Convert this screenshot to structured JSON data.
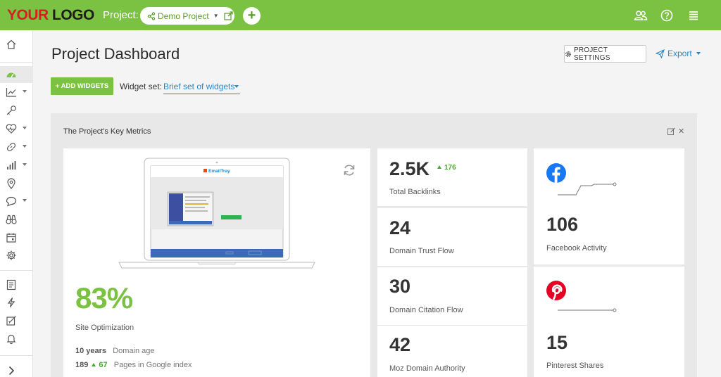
{
  "brand": {
    "logo_a": "YOUR",
    "logo_b": " LOGO"
  },
  "topbar": {
    "project_label": "Project:",
    "project_name": "Demo Project",
    "icons": [
      "share-icon",
      "chevron-down-icon",
      "external-edit-icon",
      "plus-icon",
      "users-icon",
      "help-icon",
      "menu-icon"
    ]
  },
  "sidebar": {
    "items": [
      "home-icon",
      "dashboard-icon",
      "rankings-icon",
      "keywords-icon",
      "site-audit-icon",
      "backlinks-icon",
      "analytics-icon",
      "local-icon",
      "social-icon",
      "competitors-icon",
      "calendar-icon",
      "settings-icon",
      "reports-icon",
      "alerts-icon",
      "tasks-icon",
      "notifications-icon",
      "expand-icon"
    ]
  },
  "header": {
    "title": "Project Dashboard",
    "settings_label": "PROJECT SETTINGS",
    "export_label": "Export"
  },
  "toolbar": {
    "add_widgets": "+ ADD WIDGETS",
    "widget_set_label": "Widget set:",
    "widget_set_value": "Brief set of widgets"
  },
  "panel": {
    "title": "The Project's Key Metrics",
    "screenshot_brand": "EmailTray"
  },
  "optimization": {
    "percent": "83%",
    "label": "Site Optimization",
    "domain_age_value": "10 years",
    "domain_age_label": "Domain age",
    "pages_value": "189",
    "pages_delta": "67",
    "pages_label": "Pages in Google index"
  },
  "metrics": [
    {
      "value": "2.5K",
      "delta": "176",
      "label": "Total Backlinks"
    },
    {
      "value": "24",
      "label": "Domain Trust Flow"
    },
    {
      "value": "30",
      "label": "Domain Citation Flow"
    },
    {
      "value": "42",
      "label": "Moz Domain Authority"
    }
  ],
  "social": [
    {
      "value": "106",
      "label": "Facebook Activity",
      "icon": "facebook-icon"
    },
    {
      "value": "15",
      "label": "Pinterest Shares",
      "icon": "pinterest-icon"
    }
  ],
  "colors": {
    "brand_green": "#7cc242",
    "link_blue": "#2a87c8",
    "facebook": "#1877f2",
    "pinterest": "#e60023"
  }
}
